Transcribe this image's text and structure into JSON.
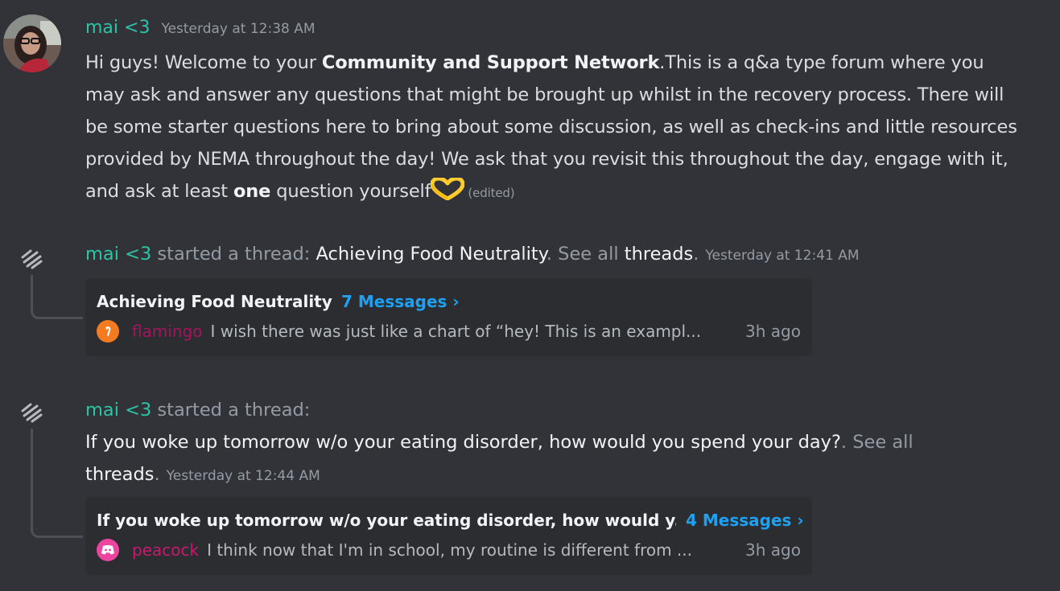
{
  "message": {
    "author": "mai <3",
    "timestamp": "Yesterday at 12:38 AM",
    "body_part1": "Hi guys! Welcome to your ",
    "body_bold1": "Community and Support Network",
    "body_part2": ".This is a q&a type forum where you may ask and answer any questions that might be brought up whilst in the recovery process. There will be some starter questions here to bring about some discussion, as well as check-ins and little resources provided by NEMA throughout the day! We ask that you revisit this throughout the day, engage with it, and ask at least ",
    "body_bold2": "one",
    "body_part3": " question yourself",
    "emoji": "heart-hands-emoji",
    "edited_label": "(edited)"
  },
  "threads": [
    {
      "author": "mai <3",
      "started_text": " started a thread: ",
      "thread_name": "Achieving Food Neutrality",
      "see_all_text": ". See all ",
      "threads_link": "threads",
      "period": ".",
      "timestamp": "Yesterday at 12:41 AM",
      "card": {
        "title": "Achieving Food Neutrality",
        "message_count": "7 Messages ›",
        "reply_user": "flamingo",
        "reply_preview": "I wish there was just like a chart of “hey! This is an exampl...",
        "reply_time": "3h ago",
        "avatar_color": "#f47b20"
      }
    },
    {
      "author": "mai <3",
      "started_text": " started a thread:",
      "thread_name": "If you woke up tomorrow w/o your eating disorder, how would you spend your day?",
      "see_all_text": ". See all",
      "threads_link": "threads",
      "period": ".",
      "timestamp": "Yesterday at 12:44 AM",
      "card": {
        "title": "If you woke up tomorrow w/o your eating disorder, how would y...",
        "message_count": "4 Messages ›",
        "reply_user": "peacock",
        "reply_preview": "I think now that I'm in school, my routine is different from ...",
        "reply_time": "3h ago",
        "avatar_color": "#eb459f"
      }
    }
  ],
  "colors": {
    "background": "#313338",
    "username": "#2dc4a6",
    "link": "#1ea1f2",
    "card": "#2b2d31"
  }
}
